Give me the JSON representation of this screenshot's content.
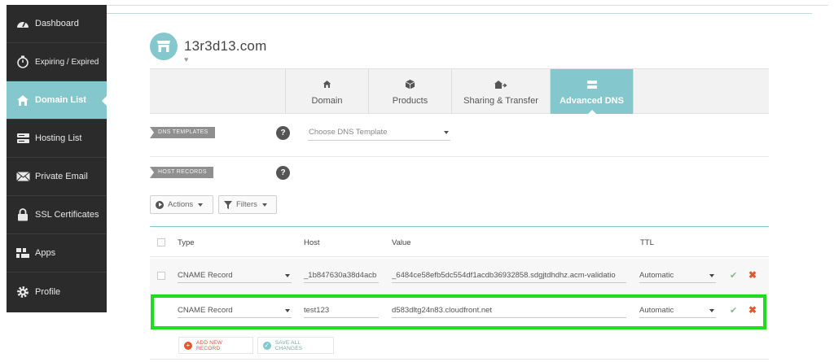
{
  "sidebar": {
    "items": [
      {
        "label": "Dashboard",
        "icon": "dashboard-icon"
      },
      {
        "label": "Expiring / Expired",
        "icon": "timer-icon"
      },
      {
        "label": "Domain List",
        "icon": "home-icon",
        "active": true
      },
      {
        "label": "Hosting List",
        "icon": "server-icon"
      },
      {
        "label": "Private Email",
        "icon": "envelope-icon"
      },
      {
        "label": "SSL Certificates",
        "icon": "lock-icon"
      },
      {
        "label": "Apps",
        "icon": "apps-icon"
      },
      {
        "label": "Profile",
        "icon": "gear-icon"
      }
    ]
  },
  "domain": {
    "name": "13r3d13.com"
  },
  "tabs": [
    {
      "label": "Domain",
      "icon": "home-icon"
    },
    {
      "label": "Products",
      "icon": "box-icon"
    },
    {
      "label": "Sharing & Transfer",
      "icon": "transfer-icon"
    },
    {
      "label": "Advanced DNS",
      "icon": "dns-icon",
      "active": true
    }
  ],
  "dns_templates": {
    "label": "DNS TEMPLATES",
    "help": "?",
    "select_placeholder": "Choose DNS Template"
  },
  "host_records": {
    "label": "HOST RECORDS",
    "help": "?"
  },
  "toolbar": {
    "actions_label": "Actions",
    "filters_label": "Filters"
  },
  "table": {
    "headers": {
      "type": "Type",
      "host": "Host",
      "value": "Value",
      "ttl": "TTL"
    },
    "rows": [
      {
        "type": "CNAME Record",
        "host": "_1b847630a38d4acb",
        "value": "_6484ce58efb5dc554df1acdb36932858.sdgjtdhdhz.acm-validatio",
        "ttl": "Automatic"
      },
      {
        "type": "CNAME Record",
        "host": "test123",
        "value": "d583dltg24n83.cloudfront.net",
        "ttl": "Automatic"
      }
    ]
  },
  "actions": {
    "add_new_record": "ADD NEW RECORD",
    "save_all_changes": "SAVE ALL CHANGES"
  },
  "colors": {
    "accent": "#84c7cd",
    "sidebar_bg": "#2b2b2b",
    "highlight": "#1edc1e",
    "delete": "#e2572e",
    "confirm": "#7dbb8a"
  }
}
